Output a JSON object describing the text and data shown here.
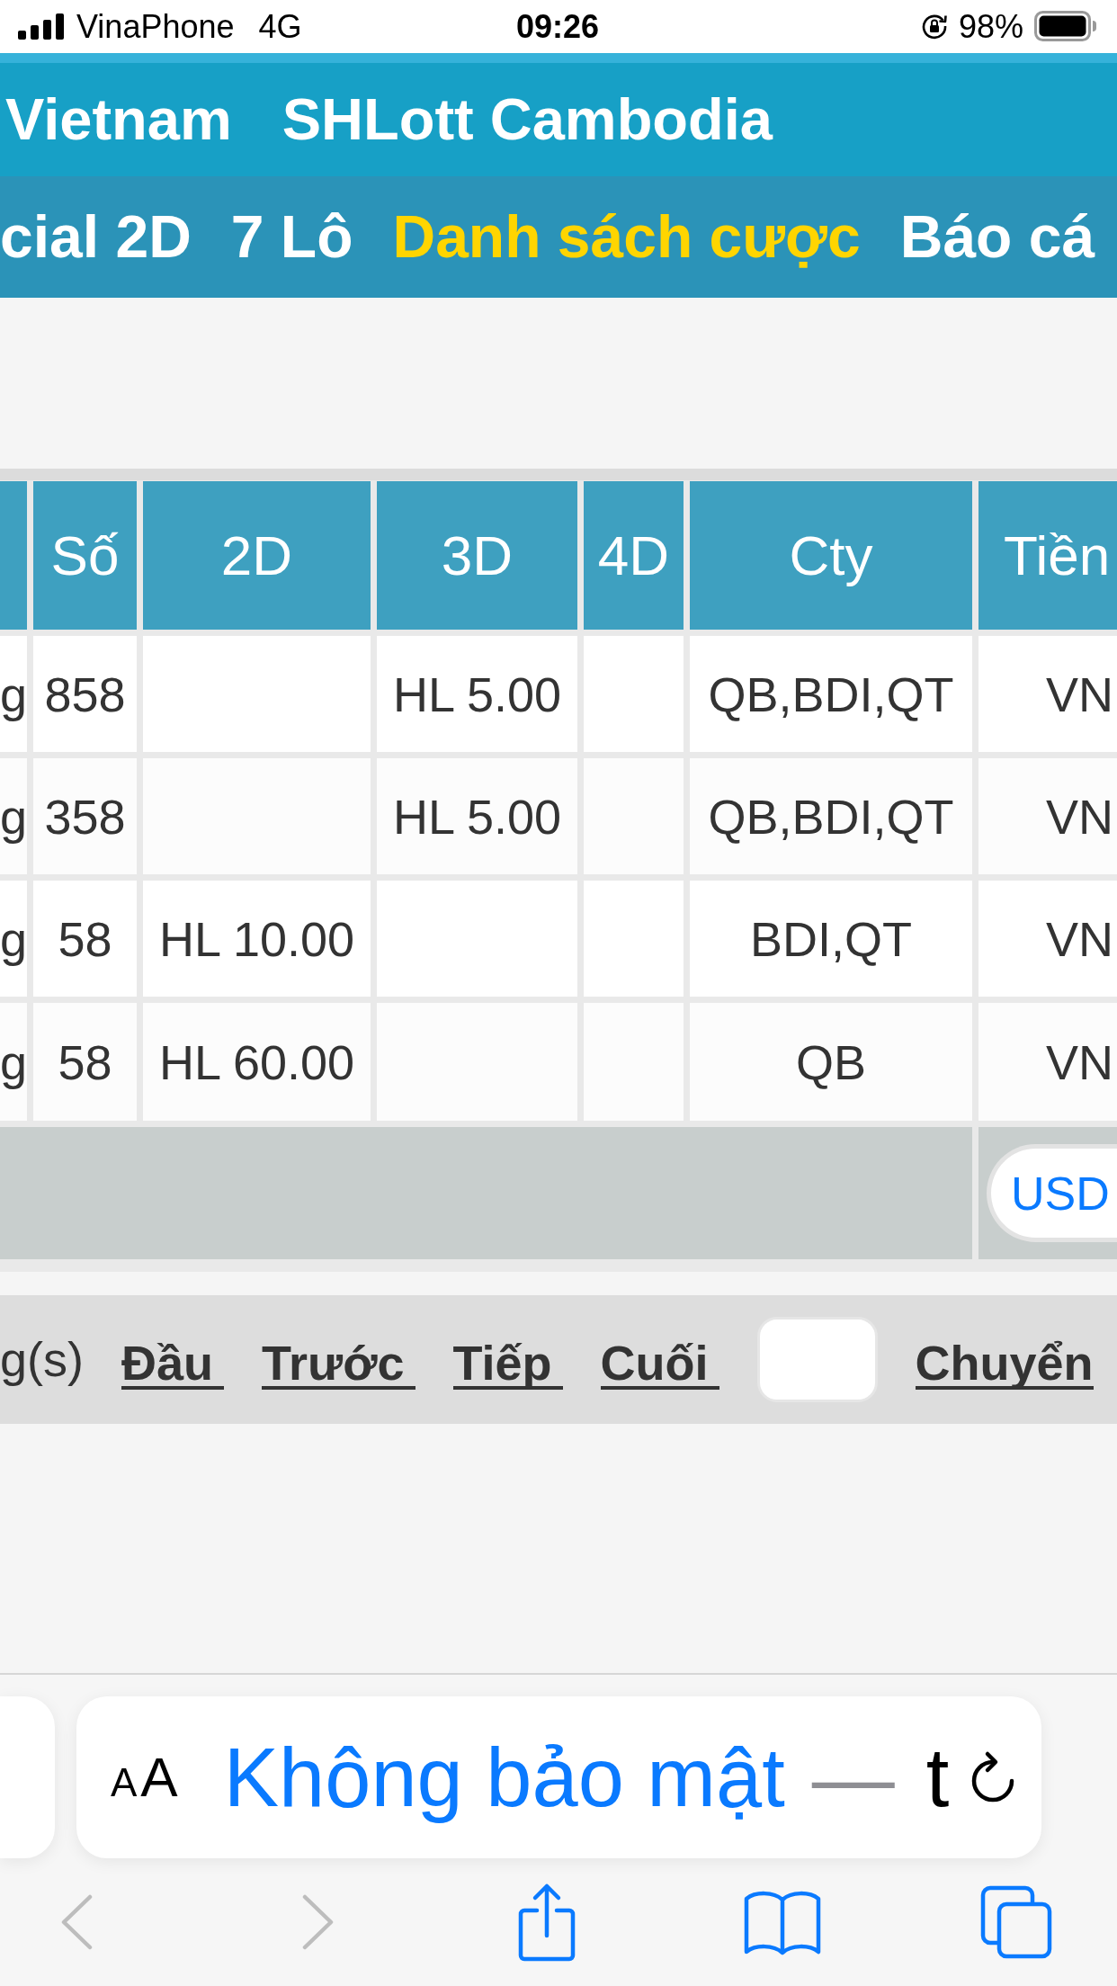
{
  "status_bar": {
    "carrier": "VinaPhone",
    "network": "4G",
    "time": "09:26",
    "battery": "98%"
  },
  "nav_primary": [
    {
      "label": "Vietnam"
    },
    {
      "label": "SHLott Cambodia"
    }
  ],
  "nav_secondary": [
    {
      "label": "cial 2D",
      "selected": false
    },
    {
      "label": "7 Lô",
      "selected": false
    },
    {
      "label": "Danh sách cược",
      "selected": true
    },
    {
      "label": "Báo cá",
      "selected": false
    }
  ],
  "table": {
    "columns": [
      "Số",
      "2D",
      "3D",
      "4D",
      "Cty",
      "Tiền"
    ],
    "rows": [
      {
        "column_1": "g",
        "so": "858",
        "3d": "HL 5.00",
        "cty": "QB,BDI,QT",
        "tien": "VN"
      },
      {
        "column_1": "g",
        "so": "358",
        "3d": "HL 5.00",
        "cty": "QB,BDI,QT",
        "tien": "VN"
      },
      {
        "column_1": "g",
        "so": "58",
        "2d": "HL 10.00",
        "cty": "BDI,QT",
        "tien": "VN"
      },
      {
        "column_1": "g",
        "so": "58",
        "2d": "HL 60.00",
        "cty": "QB",
        "tien": "VN"
      }
    ],
    "footer_row": {
      "currency_button": "USD"
    }
  },
  "pagination": {
    "count_text": "g(s)",
    "links": [
      "Đầu",
      "Trước",
      "Tiếp",
      "Cuối"
    ],
    "go_link": "Chuyển"
  },
  "browser": {
    "text_size_button": {
      "small": "A",
      "large": "A"
    },
    "security_text": "Không bảo mật",
    "separator": "—",
    "address_fragment": "t",
    "toolbar": [
      {
        "kind": "back",
        "disabled": true
      },
      {
        "kind": "forward",
        "disabled": true
      },
      {
        "kind": "share",
        "disabled": false
      },
      {
        "kind": "bookmarks",
        "disabled": false
      },
      {
        "kind": "tabs",
        "disabled": false
      }
    ]
  }
}
